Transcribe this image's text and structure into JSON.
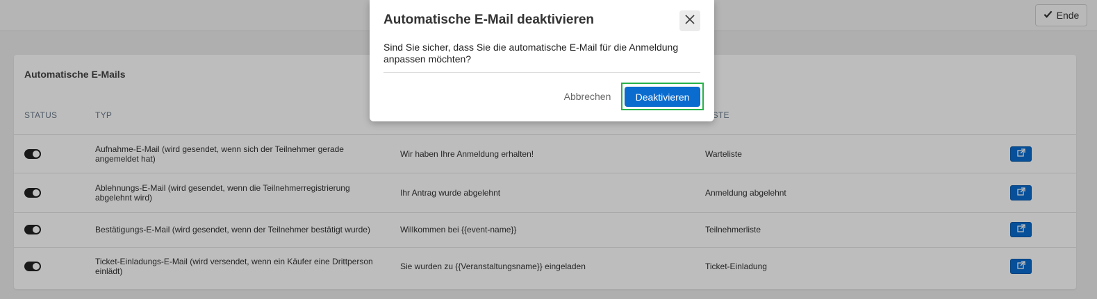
{
  "topbar": {
    "end_label": "Ende"
  },
  "card": {
    "title": "Automatische E-Mails",
    "headers": [
      "STATUS",
      "TYP",
      "",
      "LISTE"
    ],
    "rows": [
      {
        "active": true,
        "type": "Aufnahme-E-Mail (wird gesendet, wenn sich der Teilnehmer gerade angemeldet hat)",
        "subject": "Wir haben Ihre Anmeldung erhalten!",
        "list": "Warteliste"
      },
      {
        "active": true,
        "type": "Ablehnungs-E-Mail (wird gesendet, wenn die Teilnehmerregistrierung abgelehnt wird)",
        "subject": "Ihr Antrag wurde abgelehnt",
        "list": "Anmeldung abgelehnt"
      },
      {
        "active": true,
        "type": "Bestätigungs-E-Mail (wird gesendet, wenn der Teilnehmer bestätigt wurde)",
        "subject": "Willkommen bei {{event-name}}",
        "list": "Teilnehmerliste"
      },
      {
        "active": true,
        "type": "Ticket-Einladungs-E-Mail (wird versendet, wenn ein Käufer eine Drittperson einlädt)",
        "subject": "Sie wurden zu {{Veranstaltungsname}} eingeladen",
        "list": "Ticket-Einladung"
      }
    ]
  },
  "modal": {
    "title": "Automatische E-Mail deaktivieren",
    "body": "Sind Sie sicher, dass Sie die automatische E-Mail für die Anmeldung anpassen möchten?",
    "cancel_label": "Abbrechen",
    "confirm_label": "Deaktivieren"
  },
  "icons": {
    "check": "check-icon",
    "edit": "external-link-icon",
    "close": "close-icon"
  },
  "colors": {
    "primary": "#0a6ccf",
    "highlight": "#27b24a",
    "toggle_on": "#222222"
  }
}
